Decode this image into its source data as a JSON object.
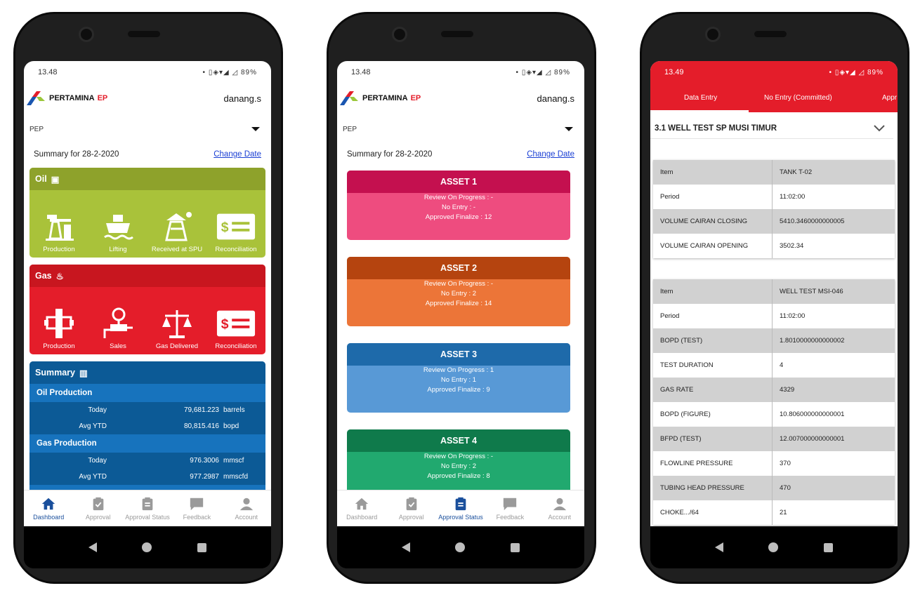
{
  "status_bar": {
    "time_1": "13.48",
    "time_2": "13.48",
    "time_3": "13.49",
    "battery": "89%"
  },
  "brand": {
    "name": "PERTAMINA",
    "suffix": "EP"
  },
  "user": "danang.s",
  "filter": {
    "selected": "PEP"
  },
  "summary_date": {
    "label": "Summary for 28-2-2020",
    "change_link": "Change Date"
  },
  "oil_card": {
    "title": "Oil",
    "tiles": [
      "Production",
      "Lifting",
      "Received at SPU",
      "Reconciliation"
    ]
  },
  "gas_card": {
    "title": "Gas",
    "tiles": [
      "Production",
      "Sales",
      "Gas Delivered",
      "Reconciliation"
    ]
  },
  "summary_card": {
    "title": "Summary",
    "oil_production": {
      "title": "Oil Production",
      "rows": [
        {
          "label": "Today",
          "value": "79,681.223",
          "unit": "barrels"
        },
        {
          "label": "Avg YTD",
          "value": "80,815.416",
          "unit": "bopd"
        }
      ]
    },
    "gas_production": {
      "title": "Gas Production",
      "rows": [
        {
          "label": "Today",
          "value": "976.3006",
          "unit": "mmscf"
        },
        {
          "label": "Avg YTD",
          "value": "977.2987",
          "unit": "mmscfd"
        }
      ]
    }
  },
  "bottom_nav": [
    "Dashboard",
    "Approval",
    "Approval Status",
    "Feedback",
    "Account"
  ],
  "assets": [
    {
      "title": "ASSET 1",
      "review": "Review On Progress : -",
      "no_entry": "No Entry : -",
      "approved": "Approved Finalize : 12",
      "head_color": "#c4104f",
      "body_color": "#ee4c7f"
    },
    {
      "title": "ASSET 2",
      "review": "Review On Progress : -",
      "no_entry": "No Entry : 2",
      "approved": "Approved Finalize : 14",
      "head_color": "#b5440f",
      "body_color": "#ec7538"
    },
    {
      "title": "ASSET 3",
      "review": "Review On Progress : 1",
      "no_entry": "No Entry : 1",
      "approved": "Approved Finalize : 9",
      "head_color": "#1e6aaa",
      "body_color": "#5899d6"
    },
    {
      "title": "ASSET 4",
      "review": "Review On Progress : -",
      "no_entry": "No Entry : 2",
      "approved": "Approved Finalize : 8",
      "head_color": "#0f7a4b",
      "body_color": "#21a96f"
    }
  ],
  "entry_tabs": [
    "Data Entry",
    "No Entry (Committed)",
    "Appr"
  ],
  "well_title": "3.1 WELL TEST SP MUSI TIMUR",
  "table1": [
    [
      "Item",
      "TANK T-02"
    ],
    [
      "Period",
      "11:02:00"
    ],
    [
      "VOLUME CAIRAN CLOSING",
      "5410.3460000000005"
    ],
    [
      "VOLUME CAIRAN OPENING",
      "3502.34"
    ]
  ],
  "table2": [
    [
      "Item",
      "WELL TEST MSI-046"
    ],
    [
      "Period",
      "11:02:00"
    ],
    [
      "BOPD (TEST)",
      "1.8010000000000002"
    ],
    [
      "TEST DURATION",
      "4"
    ],
    [
      "GAS RATE",
      "4329"
    ],
    [
      "BOPD (FIGURE)",
      "10.806000000000001"
    ],
    [
      "BFPD (TEST)",
      "12.007000000000001"
    ],
    [
      "FLOWLINE PRESSURE",
      "370"
    ],
    [
      "TUBING HEAD PRESSURE",
      "470"
    ],
    [
      "CHOKE.../64",
      "21"
    ]
  ]
}
